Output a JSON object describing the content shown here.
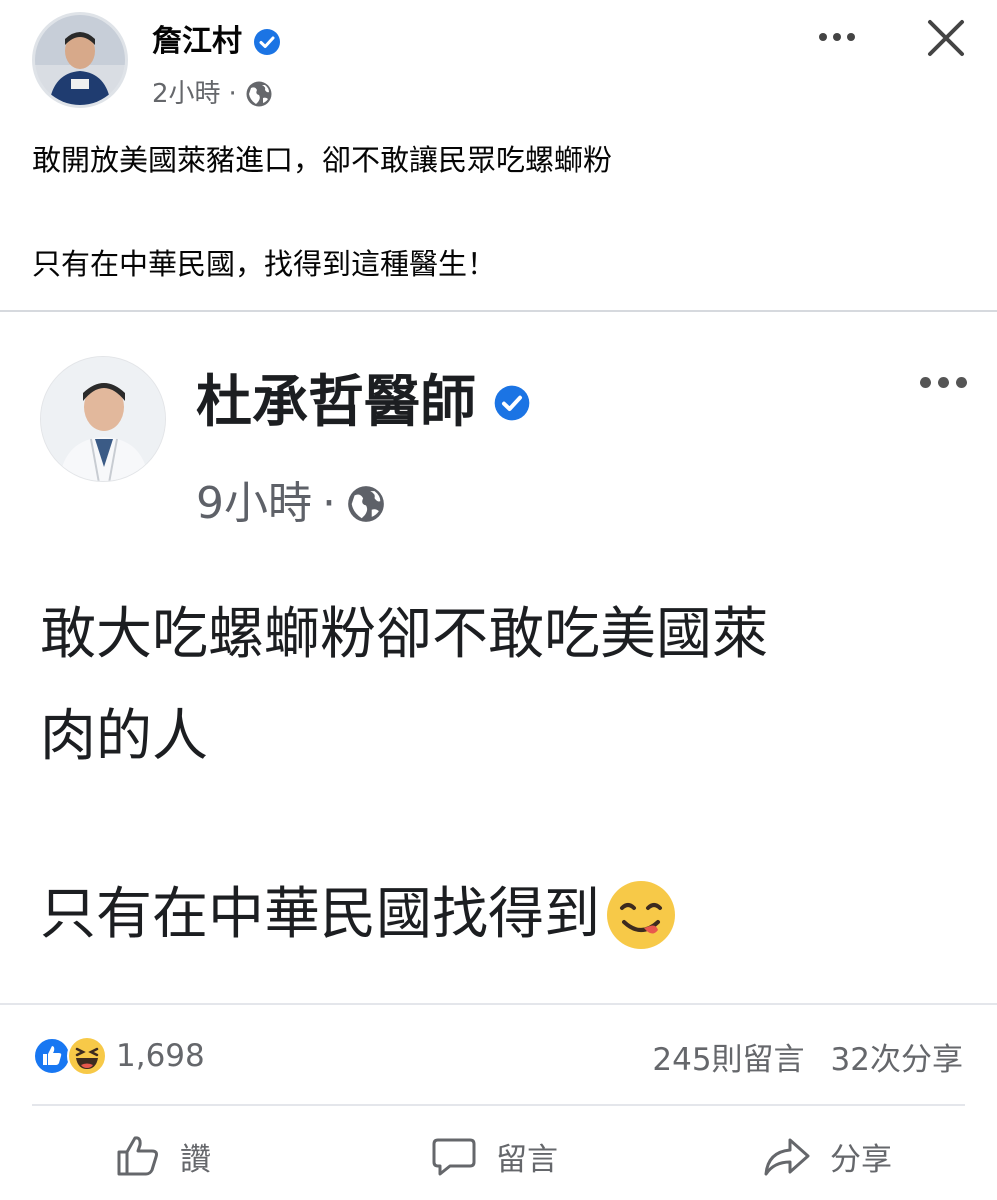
{
  "post": {
    "author": "詹江村",
    "time": "2小時",
    "separator": "·",
    "text_line1": "敢開放美國萊豬進口，卻不敢讓民眾吃螺螄粉",
    "text_line2": "只有在中華民國，找得到這種醫生！"
  },
  "shared": {
    "author": "杜承哲醫師",
    "time": "9小時",
    "separator": "·",
    "line1": "敢大吃螺螄粉卻不敢吃美國萊",
    "line2": "肉的人",
    "line3": "只有在中華民國找得到",
    "emoji": "😋"
  },
  "stats": {
    "reactions": "1,698",
    "comments": "245則留言",
    "shares": "32次分享"
  },
  "actions": {
    "like": "讚",
    "comment": "留言",
    "share": "分享"
  },
  "icons": {
    "verified": "verified-badge-icon",
    "globe": "globe-icon",
    "more": "more-dots-icon",
    "close": "close-icon",
    "like_reaction": "like-reaction-icon",
    "haha_reaction": "haha-reaction-icon"
  },
  "colors": {
    "verified_blue": "#1b74e4",
    "like_blue": "#1877f2",
    "haha_yellow": "#f7c948",
    "secondary_text": "#65676b"
  }
}
